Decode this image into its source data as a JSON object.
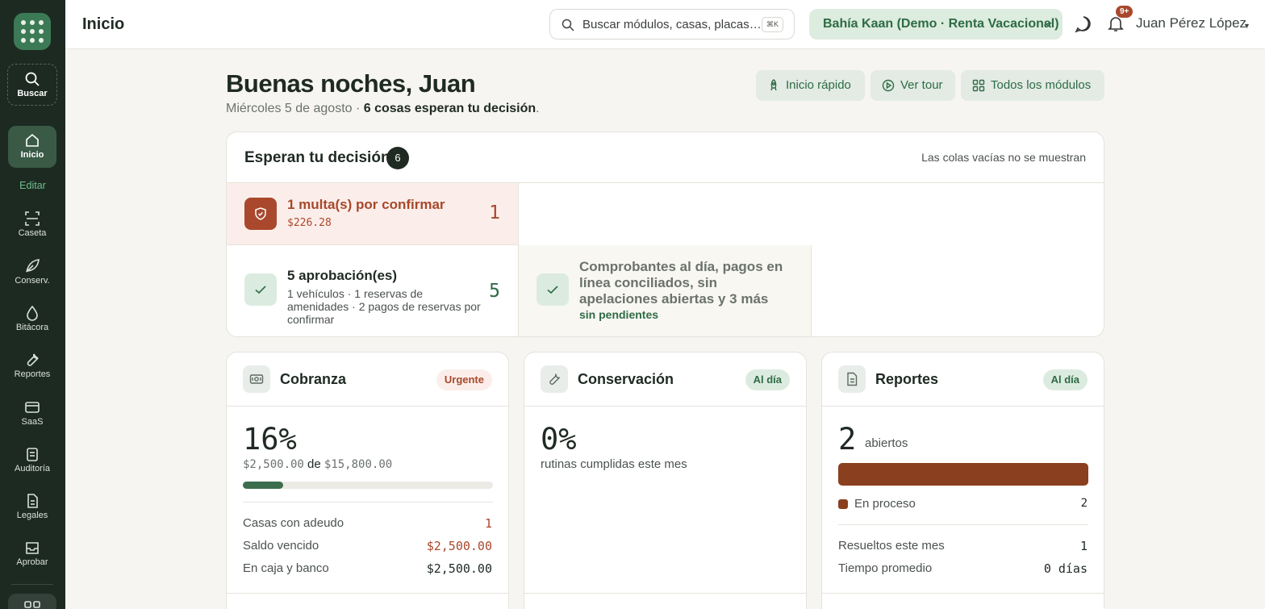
{
  "sidebar": {
    "search_label": "Buscar",
    "home_label": "Inicio",
    "edit_label": "Editar",
    "items": [
      {
        "label": "Caseta"
      },
      {
        "label": "Conserv."
      },
      {
        "label": "Bitácora"
      },
      {
        "label": "Reportes"
      },
      {
        "label": "SaaS"
      },
      {
        "label": "Auditoría"
      },
      {
        "label": "Legales"
      },
      {
        "label": "Aprobar"
      }
    ]
  },
  "header": {
    "title": "Inicio",
    "search_placeholder": "Buscar módulos, casas, placas…",
    "search_shortcut": "⌘K",
    "community": "Bahía Kaan (Demo · Renta Vacacional)",
    "notifications_badge": "9+",
    "user_name": "Juan Pérez López"
  },
  "main": {
    "greeting": "Buenas noches, Juan",
    "date": "Miércoles 5 de agosto",
    "separator": " · ",
    "pending_summary": "6 cosas esperan tu decisión",
    "period": ".",
    "quick_buttons": [
      {
        "label": "Inicio rápido"
      },
      {
        "label": "Ver tour"
      },
      {
        "label": "Todos los módulos"
      }
    ]
  },
  "decisions": {
    "title": "Esperan tu decisión",
    "count": "6",
    "note": "Las colas vacías no se muestran",
    "fines": {
      "title": "1 multa(s) por confirmar",
      "amount": "$226.28",
      "count": "1"
    },
    "approvals": {
      "title": "5 aprobación(es)",
      "detail": "1 vehículos · 1 reservas de amenidades · 2 pagos de reservas por confirmar",
      "count": "5"
    },
    "clear": {
      "title": "Comprobantes al día, pagos en línea conciliados, sin apelaciones abiertas y 3 más",
      "status": "sin pendientes"
    }
  },
  "cards": {
    "cobranza": {
      "title": "Cobranza",
      "badge": "Urgente",
      "percent": "16%",
      "collected": "$2,500.00",
      "of": "de",
      "total": "$15,800.00",
      "progress": 0.16,
      "rows": [
        {
          "label": "Casas con adeudo",
          "value": "1"
        },
        {
          "label": "Saldo vencido",
          "value": "$2,500.00"
        },
        {
          "label": "En caja y banco",
          "value": "$2,500.00"
        }
      ]
    },
    "conservacion": {
      "title": "Conservación",
      "badge": "Al día",
      "percent": "0%",
      "subtitle": "rutinas cumplidas este mes"
    },
    "reportes": {
      "title": "Reportes",
      "badge": "Al día",
      "open_count": "2",
      "open_label": "abiertos",
      "legend_label": "En proceso",
      "legend_value": "2",
      "rows": [
        {
          "label": "Resueltos este mes",
          "value": "1"
        },
        {
          "label": "Tiempo promedio",
          "value": "0 días"
        }
      ]
    }
  },
  "colors": {
    "accent": "#2e6b45",
    "sidebar": "#1d2a22",
    "urgent": "#a9482c",
    "report_bar": "#8a3f1f"
  }
}
